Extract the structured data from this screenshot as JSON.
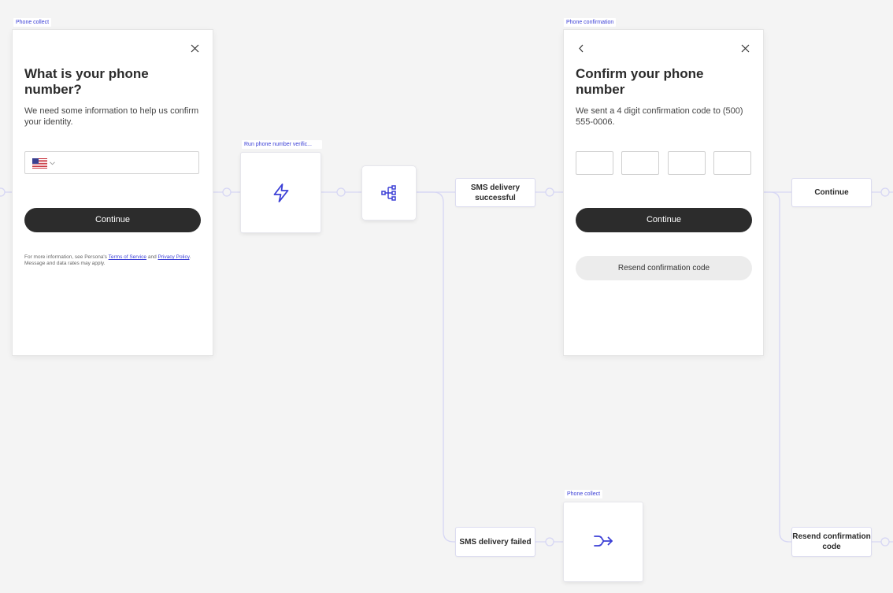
{
  "nodes": {
    "phone_collect": {
      "tag": "Phone collect",
      "heading": "What is your phone number?",
      "description": "We need some information to help us confirm your identity.",
      "country_flag": "us-flag-icon",
      "phone_value": "",
      "continue_label": "Continue",
      "legal": {
        "prefix": "For more information, see Persona's ",
        "terms": "Terms of Service",
        "and": " and ",
        "privacy": "Privacy Policy",
        "suffix": ". Message and data rates may apply."
      }
    },
    "run_verification": {
      "tag": "Run phone number verific...",
      "icon": "lightning-icon"
    },
    "branch": {
      "icon": "branch-icon"
    },
    "sms_success": {
      "label": "SMS delivery successful"
    },
    "sms_failed": {
      "label": "SMS delivery failed"
    },
    "phone_confirmation": {
      "tag": "Phone confirmation",
      "heading": "Confirm your phone number",
      "description": "We sent a 4 digit confirmation code to (500) 555-0006.",
      "code_digits": [
        "",
        "",
        "",
        ""
      ],
      "continue_label": "Continue",
      "resend_label": "Resend confirmation code"
    },
    "phone_collect_redirect": {
      "tag": "Phone collect",
      "icon": "redirect-arrow-icon"
    },
    "continue_outcome": {
      "label": "Continue"
    },
    "resend_outcome": {
      "label": "Resend confirmation code"
    }
  },
  "colors": {
    "canvas": "#f4f4f4",
    "accent": "#3b3fd6",
    "connector": "#d6d6f4",
    "primary_button": "#2c2c2c"
  }
}
